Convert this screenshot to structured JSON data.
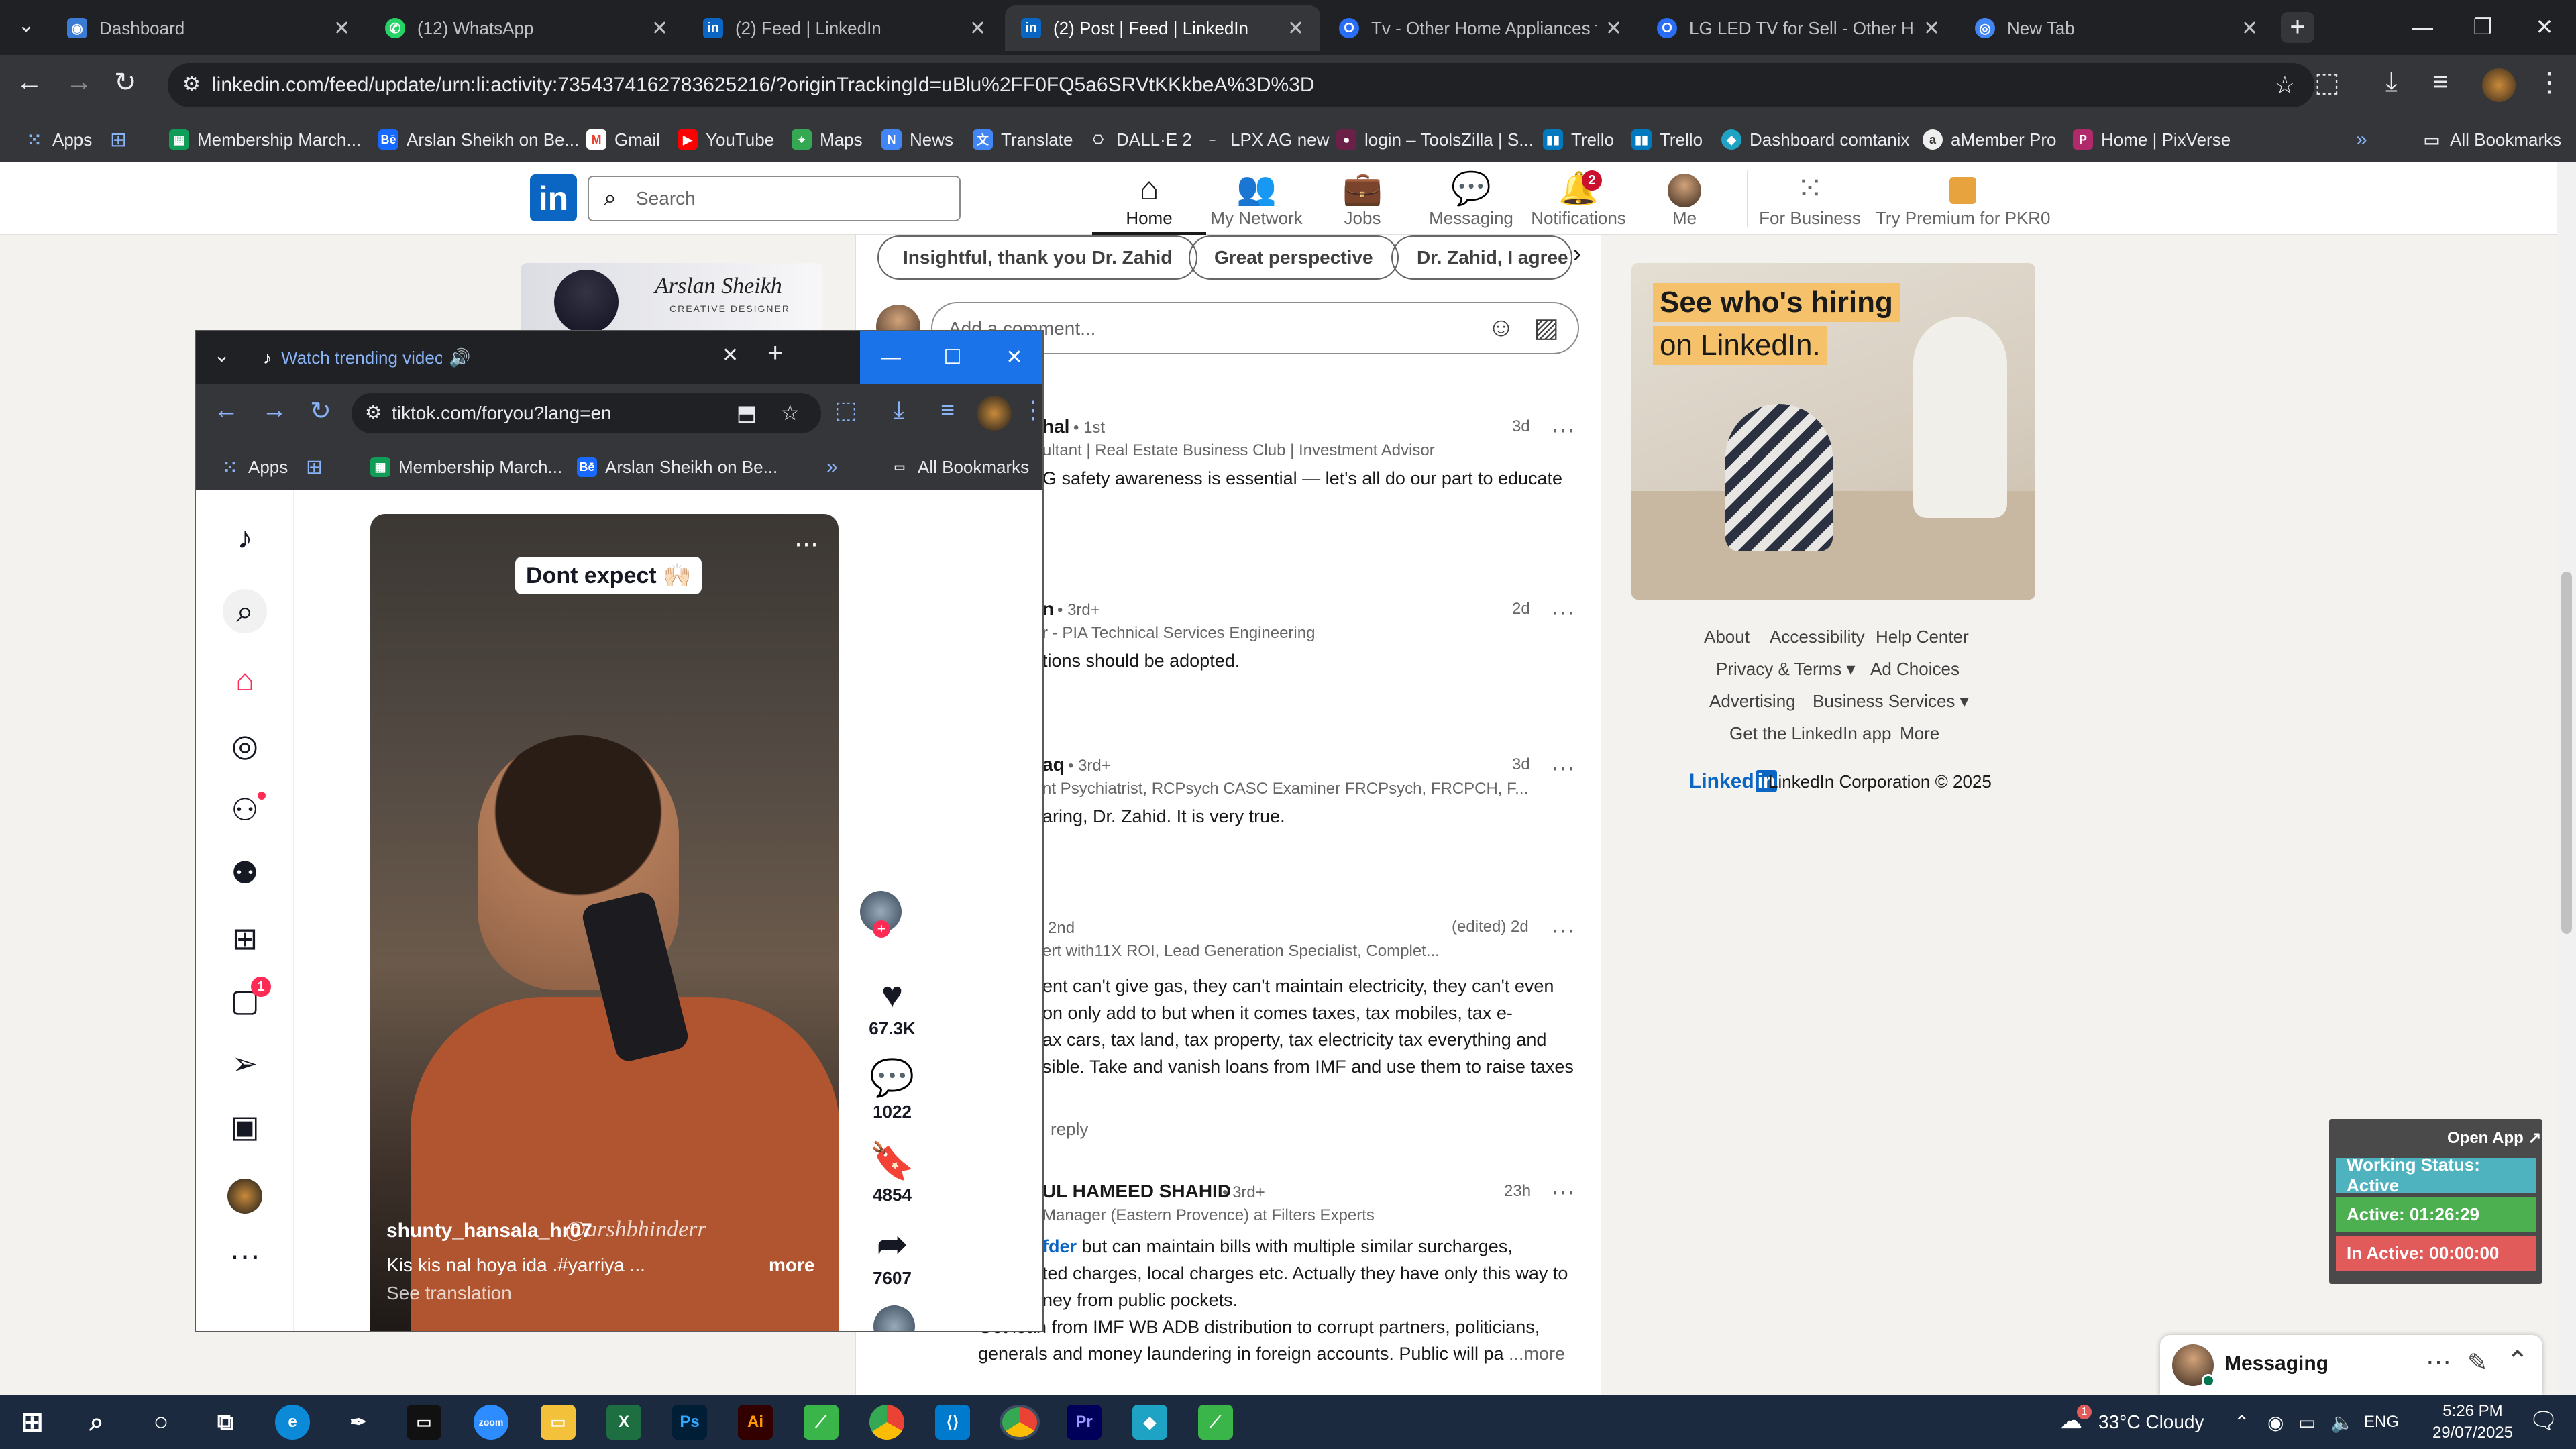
{
  "browser": {
    "tabs": [
      {
        "title": "Dashboard",
        "icon": "dashboard-icon",
        "color": "#3a7bd5"
      },
      {
        "title": "(12) WhatsApp",
        "icon": "whatsapp-icon",
        "color": "#25d366"
      },
      {
        "title": "(2) Feed | LinkedIn",
        "icon": "linkedin-icon",
        "color": "#0a66c2"
      },
      {
        "title": "(2) Post | Feed | LinkedIn",
        "icon": "linkedin-icon",
        "color": "#0a66c2"
      },
      {
        "title": "Tv - Other Home Appliances for",
        "icon": "olx-icon",
        "color": "#2a6ef5"
      },
      {
        "title": "LG LED TV for Sell - Other Hom",
        "icon": "olx-icon",
        "color": "#2a6ef5"
      },
      {
        "title": "New Tab",
        "icon": "chrome-icon",
        "color": "#4285f4"
      }
    ],
    "url": "linkedin.com/feed/update/urn:li:activity:7354374162783625216/?originTrackingId=uBlu%2FF0FQ5a6SRVtKKkbeA%3D%3D",
    "bookmarks": [
      "Apps",
      "Membership March...",
      "Arslan Sheikh on Be...",
      "Gmail",
      "YouTube",
      "Maps",
      "News",
      "Translate",
      "DALL·E 2",
      "LPX AG new",
      "login – ToolsZilla | S...",
      "Trello",
      "Trello",
      "Dashboard comtanix",
      "aMember Pro",
      "Home | PixVerse"
    ],
    "all_bookmarks": "All Bookmarks"
  },
  "linkedin": {
    "logo": "in",
    "search_placeholder": "Search",
    "nav": [
      {
        "label": "Home",
        "icon": "home-icon"
      },
      {
        "label": "My Network",
        "icon": "network-icon"
      },
      {
        "label": "Jobs",
        "icon": "jobs-icon"
      },
      {
        "label": "Messaging",
        "icon": "messaging-icon"
      },
      {
        "label": "Notifications",
        "icon": "bell-icon",
        "badge": "2"
      },
      {
        "label": "Me",
        "icon": "avatar"
      },
      {
        "label": "For Business",
        "icon": "grid-icon"
      },
      {
        "label": "Try Premium for PKR0",
        "icon": "premium-icon"
      }
    ],
    "chips": [
      "Insightful, thank you Dr. Zahid",
      "Great perspective",
      "Dr. Zahid, I agree"
    ],
    "comment_placeholder": "Add a comment...",
    "profile_card_name": "Arslan Sheikh",
    "profile_card_sub": "CREATIVE DESIGNER",
    "comments": [
      {
        "name": "hal",
        "degree": "• 1st",
        "headline": "ultant | Real Estate Business Club | Investment Advisor",
        "time": "3d",
        "text": "G safety awareness is essential — let's all do our part to educate"
      },
      {
        "name": "n",
        "degree": "• 3rd+",
        "headline": "r - PIA Technical Services Engineering",
        "time": "2d",
        "text": "tions should be adopted."
      },
      {
        "name": "aq",
        "degree": "• 3rd+",
        "headline": "nt Psychiatrist, RCPsych CASC Examiner FRCPsych, FRCPCH, F...",
        "time": "3d",
        "text": "aring, Dr. Zahid. It is very true."
      },
      {
        "name": "",
        "degree": "2nd",
        "headline": "ert with11X ROI, Lead Generation Specialist, Complet...",
        "time": "(edited) 2d",
        "text_lines": [
          "ent can't give gas, they can't maintain electricity, they can't even",
          "on only add to but when it comes taxes, tax mobiles, tax e-",
          "ax cars, tax land, tax property, tax electricity tax everything and",
          "sible. Take and vanish loans from IMF and use them to raise taxes"
        ],
        "reply": "reply"
      },
      {
        "name": "UL HAMEED SHAHID",
        "degree": "• 3rd+",
        "headline": "Manager (Eastern Provence) at Filters Experts",
        "time": "23h",
        "mention": "fder",
        "text_lines": [
          "but can maintain bills with multiple similar surcharges,",
          "ted charges, local charges etc. Actually they have only this way to",
          "ney from public pockets.",
          "Get loan from IMF WB ADB distribution to corrupt partners, politicians,",
          "generals and money laundering in foreign accounts. Public will pa"
        ],
        "more": "...more"
      }
    ],
    "ad": {
      "line1": "See who's hiring",
      "line2": "on LinkedIn."
    },
    "footer": {
      "links_row1": [
        "About",
        "Accessibility",
        "Help Center"
      ],
      "links_row2": [
        "Privacy & Terms ▾",
        "Ad Choices"
      ],
      "links_row3": [
        "Advertising",
        "Business Services ▾"
      ],
      "links_row4": [
        "Get the LinkedIn app",
        "More"
      ],
      "brand": "Linked",
      "brand_in": "in",
      "copyright": "LinkedIn Corporation © 2025"
    },
    "messaging": "Messaging"
  },
  "tiktok": {
    "window_title": "Watch trending videos for y",
    "url": "tiktok.com/foryou?lang=en",
    "bookmarks": [
      "Apps",
      "Membership March...",
      "Arslan Sheikh on Be..."
    ],
    "all_bookmarks": "All Bookmarks",
    "sidebar_badges": {
      "inbox": "1"
    },
    "video_caption_top": "Dont expect 🙌🏻",
    "username": "shunty_hansala_hr07",
    "watermark": "@arshbhinderr",
    "description": "Kis kis nal hoya ida .#yarriya ...",
    "more": "more",
    "see_translation": "See translation",
    "actions": {
      "likes": "67.3K",
      "comments": "1022",
      "saves": "4854",
      "shares": "7607"
    }
  },
  "widget": {
    "open_app": "Open App ↗",
    "working": "Working Status: Active",
    "active": "Active: 01:26:29",
    "inactive": "In Active: 00:00:00",
    "colors": {
      "working": "#4fb3bf",
      "active": "#4caf50",
      "inactive": "#e25b5b"
    }
  },
  "taskbar": {
    "weather": "33°C  Cloudy",
    "weather_badge": "1",
    "lang": "ENG",
    "time": "5:26 PM",
    "date": "29/07/2025"
  }
}
